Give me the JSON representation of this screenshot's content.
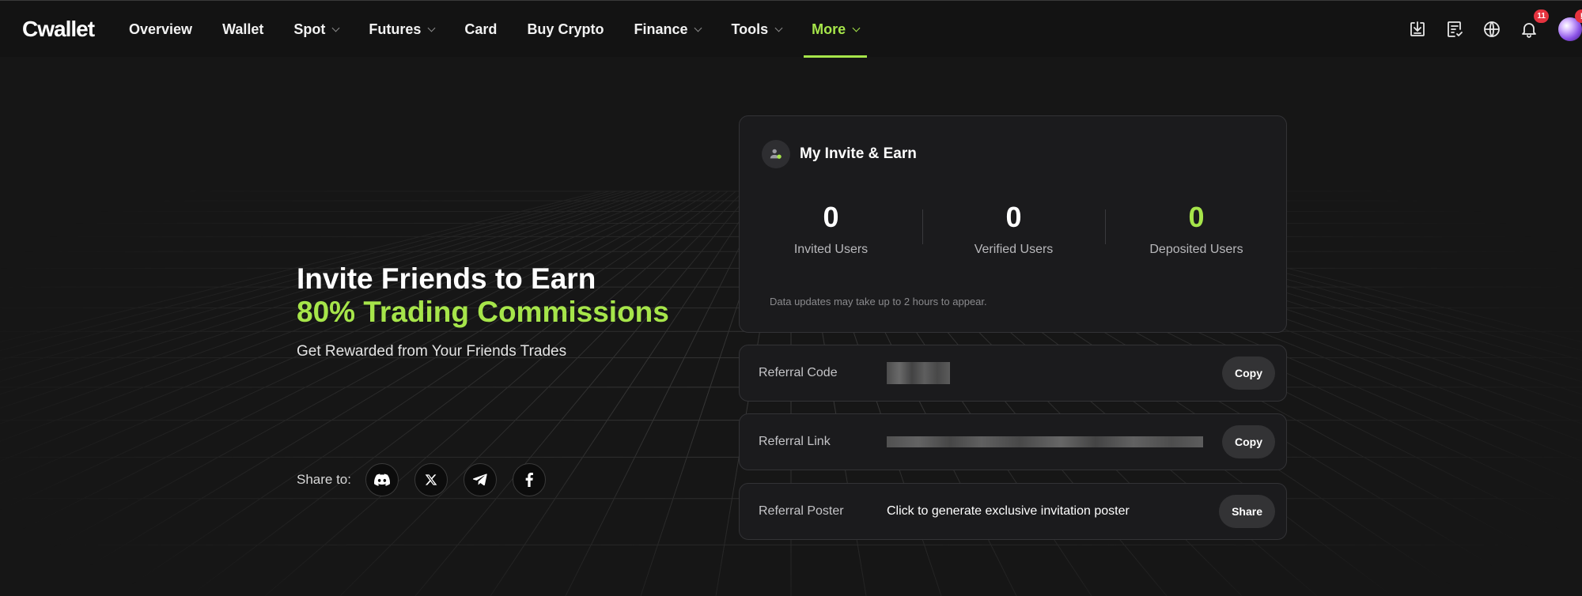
{
  "colors": {
    "accent": "#a6e54a",
    "background": "#161616",
    "card": "#1b1b1d",
    "badge": "#e5333f"
  },
  "header": {
    "logo": "Cwallet",
    "nav": [
      {
        "label": "Overview",
        "dropdown": false
      },
      {
        "label": "Wallet",
        "dropdown": false
      },
      {
        "label": "Spot",
        "dropdown": true
      },
      {
        "label": "Futures",
        "dropdown": true
      },
      {
        "label": "Card",
        "dropdown": false
      },
      {
        "label": "Buy Crypto",
        "dropdown": false
      },
      {
        "label": "Finance",
        "dropdown": true
      },
      {
        "label": "Tools",
        "dropdown": true
      },
      {
        "label": "More",
        "dropdown": true,
        "active": true
      }
    ],
    "icons": [
      "download-icon",
      "orders-icon",
      "globe-icon",
      "bell-icon"
    ],
    "notification_count": "11",
    "avatar_alert": "!"
  },
  "hero": {
    "title": "Invite Friends to Earn",
    "accent": "80% Trading Commissions",
    "subtitle": "Get Rewarded from Your Friends Trades",
    "share_label": "Share to:",
    "share_icons": [
      "discord-icon",
      "x-icon",
      "telegram-icon",
      "facebook-icon"
    ]
  },
  "invite_card": {
    "title": "My Invite & Earn",
    "stats": [
      {
        "value": "0",
        "label": "Invited Users"
      },
      {
        "value": "0",
        "label": "Verified Users"
      },
      {
        "value": "0",
        "label": "Deposited Users"
      }
    ],
    "note": "Data updates may take up to 2 hours to appear."
  },
  "referral": {
    "code_label": "Referral Code",
    "code_button": "Copy",
    "link_label": "Referral Link",
    "link_button": "Copy",
    "poster_label": "Referral Poster",
    "poster_text": "Click to generate exclusive invitation poster",
    "poster_button": "Share"
  }
}
